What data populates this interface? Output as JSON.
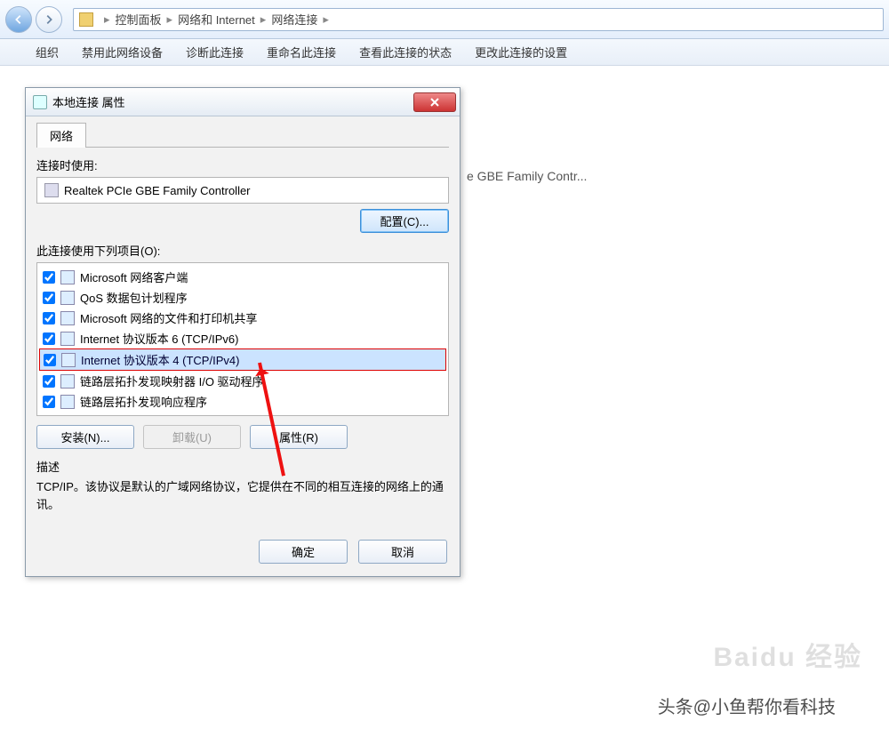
{
  "breadcrumb": {
    "p1": "控制面板",
    "p2": "网络和 Internet",
    "p3": "网络连接"
  },
  "menubar": {
    "m1": "组织",
    "m2": "禁用此网络设备",
    "m3": "诊断此连接",
    "m4": "重命名此连接",
    "m5": "查看此连接的状态",
    "m6": "更改此连接的设置"
  },
  "bg": {
    "adapter_tail": "e GBE Family Contr..."
  },
  "dialog": {
    "title": "本地连接 属性",
    "tab": "网络",
    "connect_label": "连接时使用:",
    "adapter": "Realtek PCIe GBE Family Controller",
    "configure_btn": "配置(C)...",
    "items_label": "此连接使用下列项目(O):",
    "items": [
      "Microsoft 网络客户端",
      "QoS 数据包计划程序",
      "Microsoft 网络的文件和打印机共享",
      "Internet 协议版本 6 (TCP/IPv6)",
      "Internet 协议版本 4 (TCP/IPv4)",
      "链路层拓扑发现映射器 I/O 驱动程序",
      "链路层拓扑发现响应程序"
    ],
    "install_btn": "安装(N)...",
    "uninstall_btn": "卸载(U)",
    "props_btn": "属性(R)",
    "desc_hd": "描述",
    "desc": "TCP/IP。该协议是默认的广域网络协议，它提供在不同的相互连接的网络上的通讯。",
    "ok": "确定",
    "cancel": "取消"
  },
  "watermark": {
    "brand": "Baidu 经验",
    "author": "头条@小鱼帮你看科技"
  }
}
